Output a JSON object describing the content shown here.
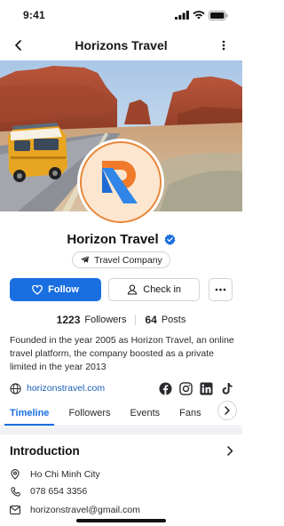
{
  "status_bar": {
    "time": "9:41"
  },
  "nav": {
    "title": "Horizons Travel",
    "back_icon": "back-arrow-icon",
    "menu_icon": "vertical-dots-icon"
  },
  "profile": {
    "name": "Horizon Travel",
    "verified": true,
    "category": "Travel Company",
    "category_icon": "airplane-icon",
    "brand_colors": {
      "primary": "#1a6fe0",
      "logo_orange": "#f07a2a",
      "logo_blue": "#2f86e8",
      "avatar_ring": "#e8873a"
    }
  },
  "actions": {
    "follow_label": "Follow",
    "checkin_label": "Check in"
  },
  "stats": {
    "followers_count": "1223",
    "followers_label": "Followers",
    "posts_count": "64",
    "posts_label": "Posts"
  },
  "bio": "Founded in the year 2005 as Horizon Travel, an online travel platform, the company boosted as a private limited in the year 2013",
  "links": {
    "website": "horizonstravel.com",
    "socials": [
      "facebook-icon",
      "instagram-icon",
      "linkedin-icon",
      "tiktok-icon"
    ]
  },
  "tabs": [
    {
      "label": "Timeline",
      "active": true
    },
    {
      "label": "Followers",
      "active": false
    },
    {
      "label": "Events",
      "active": false
    },
    {
      "label": "Fans",
      "active": false
    }
  ],
  "intro": {
    "title": "Introduction",
    "location": "Ho Chi Minh City",
    "phone": "078 654 3356",
    "email": "horizonstravel@gmail.com"
  }
}
